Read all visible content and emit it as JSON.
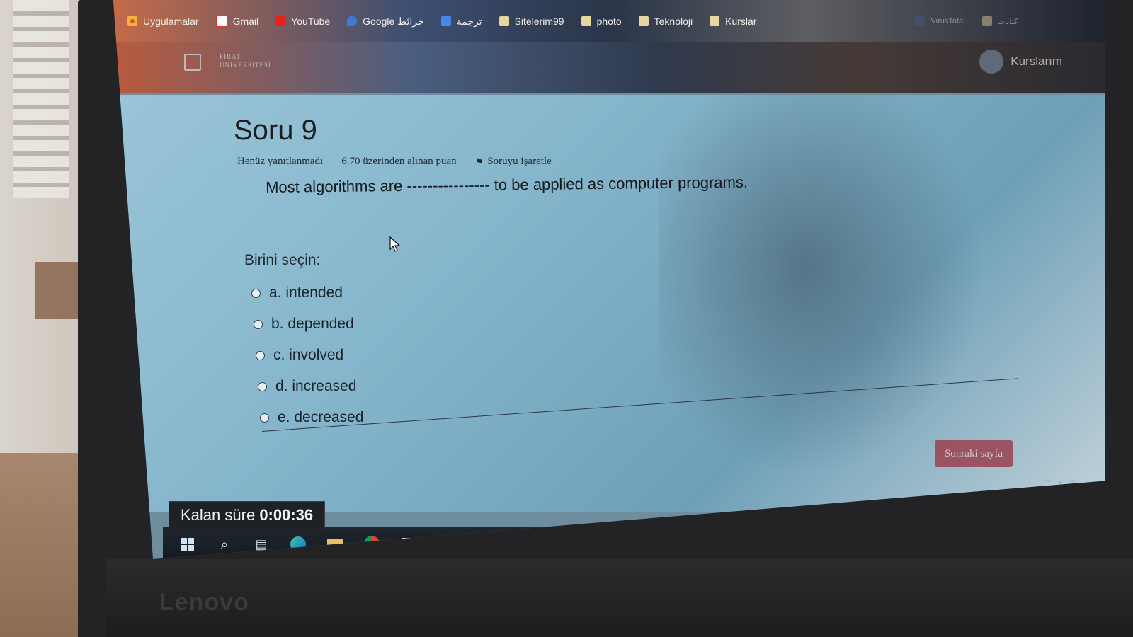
{
  "bookmarks": [
    {
      "label": "Uygulamalar",
      "icon": "apps-grid-icon",
      "color": "#e24a3a"
    },
    {
      "label": "Gmail",
      "icon": "gmail-icon",
      "color": "#ffffff"
    },
    {
      "label": "YouTube",
      "icon": "youtube-icon",
      "color": "#e62117"
    },
    {
      "label": "Google خرائط",
      "icon": "google-maps-icon",
      "color": "#3b7cdb"
    },
    {
      "label": "ترجمة",
      "icon": "google-translate-icon",
      "color": "#4a86e8"
    },
    {
      "label": "Sitelerim99",
      "icon": "folder-icon",
      "color": "#e8d6a0"
    },
    {
      "label": "photo",
      "icon": "folder-icon",
      "color": "#e8d6a0"
    },
    {
      "label": "Teknoloji",
      "icon": "folder-icon",
      "color": "#e8d6a0"
    },
    {
      "label": "Kurslar",
      "icon": "folder-icon",
      "color": "#e8d6a0"
    }
  ],
  "bookmarks_right": [
    {
      "label": "VirusTotal",
      "icon": "virustotal-icon"
    },
    {
      "label": "كتابات",
      "icon": "folder-icon"
    }
  ],
  "site": {
    "logo_line1": "FIRAT",
    "logo_line2": "ÜNİVERSİTESİ",
    "my_courses": "Kurslarım"
  },
  "question": {
    "title": "Soru 9",
    "status": "Henüz yanıtlanmadı",
    "points": "6.70 üzerinden alınan puan",
    "flag_label": "Soruyu işaretle",
    "text": "Most algorithms are ---------------- to be applied as computer programs.",
    "choose_prompt": "Birini seçin:",
    "options": [
      {
        "label": "a. intended"
      },
      {
        "label": "b. depended"
      },
      {
        "label": "c. involved"
      },
      {
        "label": "d. increased"
      },
      {
        "label": "e. decreased"
      }
    ]
  },
  "next_button": "Sonraki sayfa",
  "timer": {
    "label": "Kalan süre",
    "value": "0:00:36"
  },
  "taskbar": [
    {
      "icon": "windows-start-icon"
    },
    {
      "icon": "search-icon"
    },
    {
      "icon": "task-view-icon"
    },
    {
      "icon": "edge-browser-icon"
    },
    {
      "icon": "file-explorer-icon"
    },
    {
      "icon": "chrome-icon"
    },
    {
      "icon": "store-icon"
    },
    {
      "icon": "telegram-icon"
    },
    {
      "icon": "powerpoint-icon"
    },
    {
      "icon": "excel-icon"
    },
    {
      "icon": "word-icon"
    }
  ],
  "device_brand": "Lenovo"
}
